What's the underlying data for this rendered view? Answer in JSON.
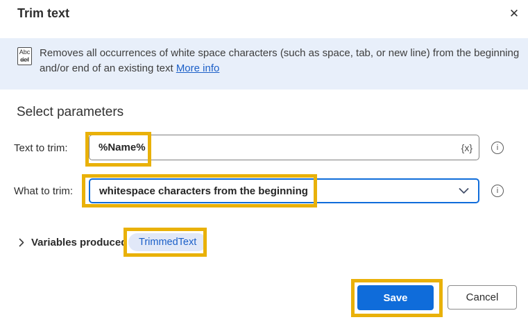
{
  "dialog": {
    "title": "Trim text"
  },
  "icons": {
    "close_glyph": "✕",
    "info_glyph": "i",
    "fx_glyph": "{x}"
  },
  "banner": {
    "icon_top": "Abc",
    "icon_bottom": "def",
    "line1": "Removes all occurrences of white space characters (such as space, tab, or new line) from the beginning",
    "line2": "and/or end of an existing text",
    "link": "More info"
  },
  "parameters": {
    "heading": "Select parameters",
    "text_to_trim": {
      "label": "Text to trim:",
      "value": "%Name%"
    },
    "what_to_trim": {
      "label": "What to trim:",
      "value": "whitespace characters from the beginning"
    }
  },
  "variables": {
    "label": "Variables produced",
    "pill": "TrimmedText"
  },
  "footer": {
    "save": "Save",
    "cancel": "Cancel"
  },
  "colors": {
    "accent_blue": "#0f6cda",
    "banner_bg": "#e8effa",
    "link_blue": "#1b5fc8",
    "pill_bg": "#e1e8f8",
    "pill_text": "#1b5fc8",
    "highlight_gold": "#e9b109"
  }
}
